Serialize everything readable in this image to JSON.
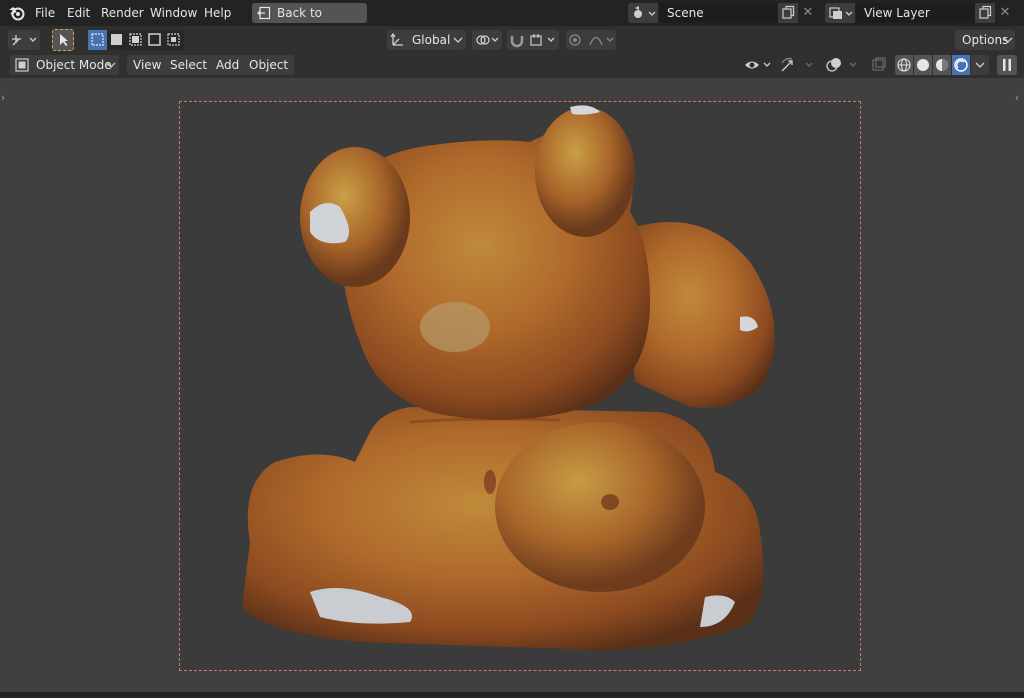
{
  "topbar": {
    "menus": [
      "File",
      "Edit",
      "Render",
      "Window",
      "Help"
    ],
    "back_button": "Back to Previous",
    "scene": {
      "label": "Scene"
    },
    "view_layer": {
      "label": "View Layer"
    }
  },
  "toolbar": {
    "transform_orientation": "Global",
    "options_label": "Options"
  },
  "viewport_header": {
    "mode": "Object Mode",
    "menus": [
      "View",
      "Select",
      "Add",
      "Object"
    ]
  },
  "colors": {
    "topbar_bg": "#232323",
    "header_bg": "#303030",
    "viewport_bg": "#404040",
    "camera_frame": "#d07a66",
    "accent": "#4772b3"
  },
  "viewport": {
    "subject": "textured 3D scan of a clay bear figurine"
  }
}
